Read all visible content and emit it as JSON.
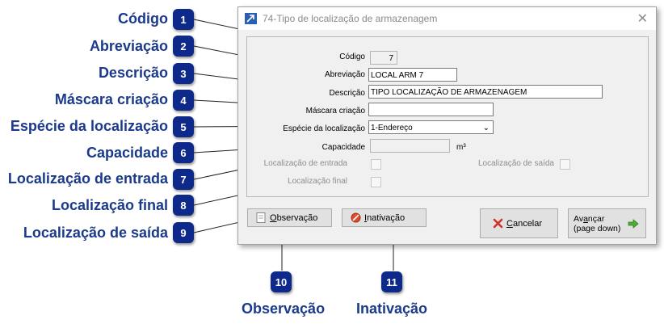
{
  "callouts": [
    {
      "num": "1",
      "label": "Código"
    },
    {
      "num": "2",
      "label": "Abreviação"
    },
    {
      "num": "3",
      "label": "Descrição"
    },
    {
      "num": "4",
      "label": "Máscara criação"
    },
    {
      "num": "5",
      "label": "Espécie da localização"
    },
    {
      "num": "6",
      "label": "Capacidade"
    },
    {
      "num": "7",
      "label": "Localização de entrada"
    },
    {
      "num": "8",
      "label": "Localização final"
    },
    {
      "num": "9",
      "label": "Localização de saída"
    },
    {
      "num": "10",
      "label": "Observação"
    },
    {
      "num": "11",
      "label": "Inativação"
    }
  ],
  "window": {
    "title": "74-Tipo de localização de armazenagem",
    "close_glyph": "✕"
  },
  "form": {
    "codigo_label": "Código",
    "codigo_value": "7",
    "abreviacao_label": "Abreviação",
    "abreviacao_value": "LOCAL ARM 7",
    "descricao_label": "Descrição",
    "descricao_value": "TIPO LOCALIZAÇÃO DE ARMAZENAGEM",
    "mascara_label": "Máscara criação",
    "mascara_value": "",
    "especie_label": "Espécie da localização",
    "especie_value": "1-Endereço",
    "capacidade_label": "Capacidade",
    "capacidade_value": "",
    "capacidade_unit": "m³",
    "loc_entrada_label": "Localização de entrada",
    "loc_final_label": "Localização final",
    "loc_saida_label": "Localização de saída"
  },
  "buttons": {
    "observacao_first": "O",
    "observacao_rest": "bservação",
    "inativacao_first": "I",
    "inativacao_rest": "nativação",
    "cancelar_first": "C",
    "cancelar_rest": "ancelar",
    "avancar_line1_pre": "Av",
    "avancar_line1_u": "a",
    "avancar_line1_post": "nçar",
    "avancar_line2": "(page down)"
  },
  "colors": {
    "callout_text": "#1b3a8c",
    "badge_bg": "#0d2a8a"
  }
}
